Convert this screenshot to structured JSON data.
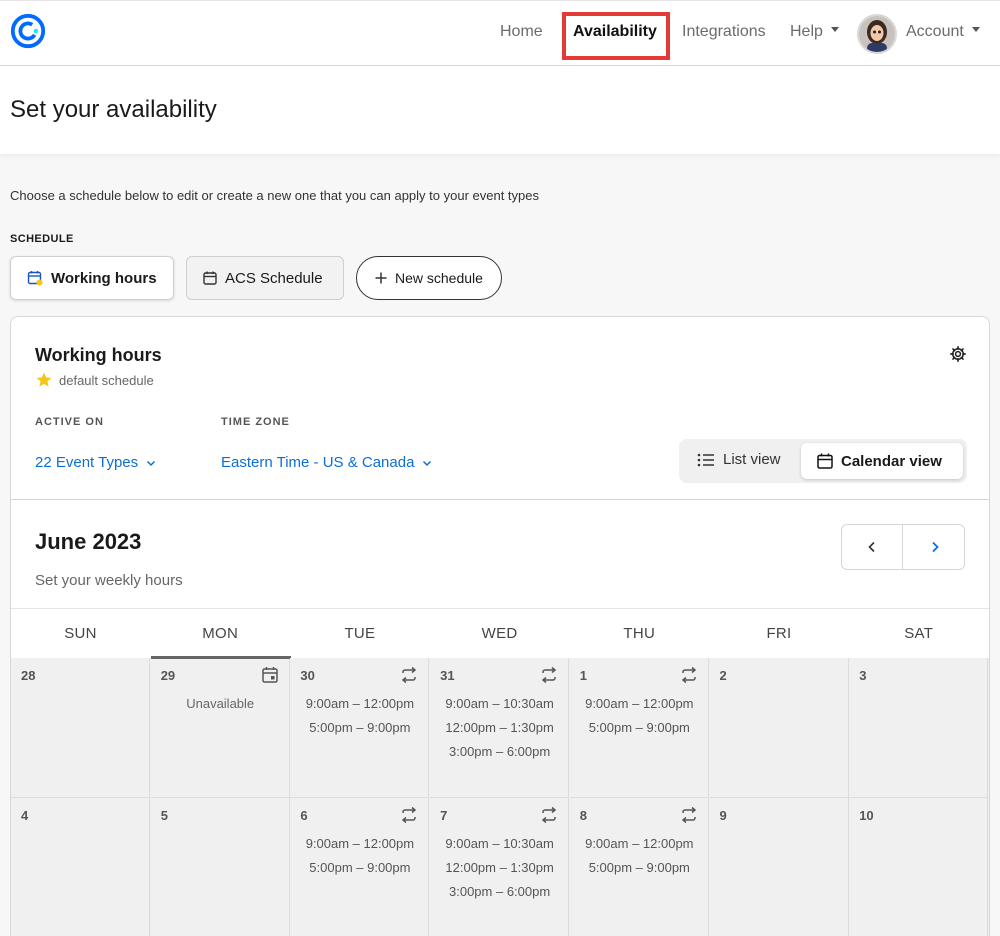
{
  "nav": {
    "home": "Home",
    "availability": "Availability",
    "integrations": "Integrations",
    "help": "Help",
    "account": "Account"
  },
  "header": {
    "title": "Set your availability"
  },
  "intro": "Choose a schedule below to edit or create a new one that you can apply to your event types",
  "schedule": {
    "label": "SCHEDULE",
    "tabs": [
      "Working hours",
      "ACS Schedule"
    ],
    "new_label": "New schedule"
  },
  "card": {
    "title": "Working hours",
    "default_label": "default schedule",
    "active_on_label": "ACTIVE ON",
    "time_zone_label": "TIME ZONE",
    "event_types": "22 Event Types",
    "time_zone": "Eastern Time - US & Canada",
    "list_view": "List view",
    "calendar_view": "Calendar view"
  },
  "calendar": {
    "month": "June 2023",
    "subtitle": "Set your weekly hours",
    "days": [
      "SUN",
      "MON",
      "TUE",
      "WED",
      "THU",
      "FRI",
      "SAT"
    ],
    "weeks": [
      [
        {
          "num": "28",
          "slots": []
        },
        {
          "num": "29",
          "unavailable": "Unavailable",
          "icon": "calendar-edit-icon",
          "today": true
        },
        {
          "num": "30",
          "slots": [
            "9:00am – 12:00pm",
            "5:00pm – 9:00pm"
          ],
          "icon": "repeat-icon"
        },
        {
          "num": "31",
          "slots": [
            "9:00am – 10:30am",
            "12:00pm – 1:30pm",
            "3:00pm – 6:00pm"
          ],
          "icon": "repeat-icon"
        },
        {
          "num": "1",
          "slots": [
            "9:00am – 12:00pm",
            "5:00pm – 9:00pm"
          ],
          "icon": "repeat-icon"
        },
        {
          "num": "2",
          "slots": []
        },
        {
          "num": "3",
          "slots": []
        }
      ],
      [
        {
          "num": "4",
          "slots": []
        },
        {
          "num": "5",
          "slots": []
        },
        {
          "num": "6",
          "slots": [
            "9:00am – 12:00pm",
            "5:00pm – 9:00pm"
          ],
          "icon": "repeat-icon"
        },
        {
          "num": "7",
          "slots": [
            "9:00am – 10:30am",
            "12:00pm – 1:30pm",
            "3:00pm – 6:00pm"
          ],
          "icon": "repeat-icon"
        },
        {
          "num": "8",
          "slots": [
            "9:00am – 12:00pm",
            "5:00pm – 9:00pm"
          ],
          "icon": "repeat-icon"
        },
        {
          "num": "9",
          "slots": []
        },
        {
          "num": "10",
          "slots": []
        }
      ]
    ]
  },
  "colors": {
    "accent": "#0b6fd6",
    "highlight_box": "#e53935",
    "star": "#f5c518"
  }
}
